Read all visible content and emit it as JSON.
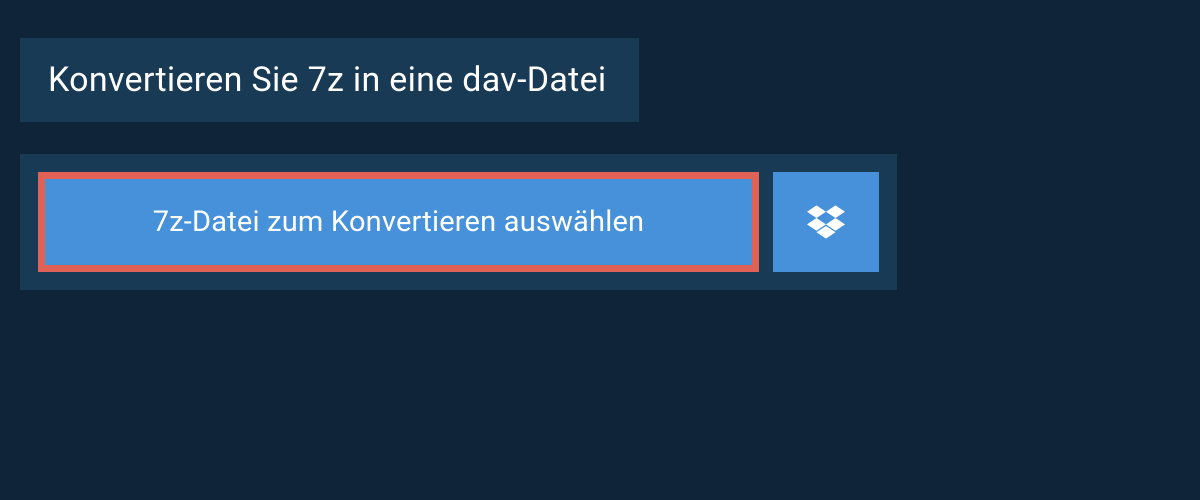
{
  "header": {
    "title": "Konvertieren Sie 7z in eine dav-Datei"
  },
  "converter": {
    "file_select_label": "7z-Datei zum Konvertieren auswählen",
    "dropbox_icon_name": "dropbox-icon"
  },
  "colors": {
    "background": "#0f2438",
    "panel": "#183a54",
    "button": "#4791db",
    "highlight_border": "#e06257",
    "text": "#ffffff"
  }
}
